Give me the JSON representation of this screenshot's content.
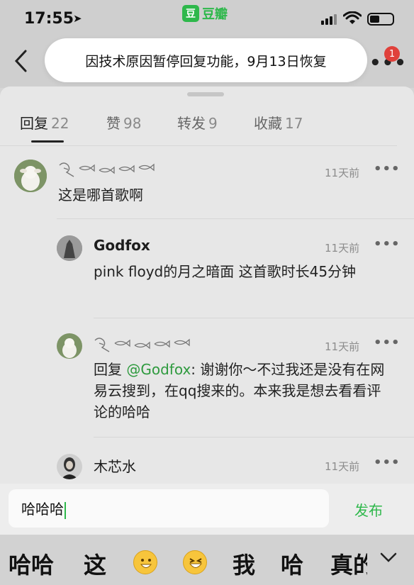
{
  "status": {
    "time": "17:55",
    "app_name": "豆瓣"
  },
  "nav": {
    "back_icon": "chevron-left-icon",
    "notification_count": "1"
  },
  "toast": {
    "text": "因技术原因暂停回复功能，9月13日恢复"
  },
  "tabs": [
    {
      "label": "回复",
      "count": "22"
    },
    {
      "label": "赞",
      "count": "98"
    },
    {
      "label": "转发",
      "count": "9"
    },
    {
      "label": "收藏",
      "count": "17"
    }
  ],
  "comments": [
    {
      "username": "",
      "time": "11天前",
      "text": "这是哪首歌啊"
    },
    {
      "username": "Godfox",
      "time": "11天前",
      "text": "pink floyd的月之暗面 这首歌时长45分钟"
    },
    {
      "username": "",
      "time": "11天前",
      "reply_prefix": "回复 ",
      "mention": "@Godfox",
      "text": ": 谢谢你～不过我还是没有在网易云搜到，在qq搜来的。本来我是想去看看评论的哈哈"
    },
    {
      "username": "木芯水",
      "time": "11天前",
      "text": ""
    }
  ],
  "input": {
    "value": "哈哈哈",
    "send_label": "发布"
  },
  "keyboard": {
    "suggestions": [
      "哈哈",
      "这",
      "我",
      "哈",
      "真的"
    ]
  },
  "colors": {
    "accent": "#2eb84b",
    "badge": "#e0413b",
    "mention": "#2e9a3e"
  }
}
